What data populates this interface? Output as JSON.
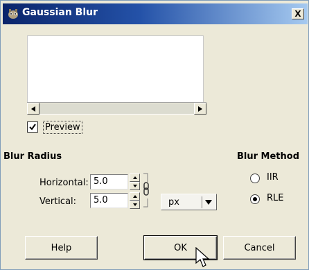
{
  "window": {
    "title": "Gaussian Blur",
    "close_label": "X"
  },
  "preview": {
    "checkbox_checked": true,
    "label": "Preview"
  },
  "blur_radius": {
    "section_title": "Blur Radius",
    "horizontal_label": "Horizontal:",
    "horizontal_value": "5.0",
    "vertical_label": "Vertical:",
    "vertical_value": "5.0",
    "unit": "px",
    "chain_linked": true
  },
  "blur_method": {
    "section_title": "Blur Method",
    "options": [
      {
        "label": "IIR",
        "selected": false
      },
      {
        "label": "RLE",
        "selected": true
      }
    ]
  },
  "buttons": {
    "help": "Help",
    "ok": "OK",
    "cancel": "Cancel"
  },
  "icons": {
    "title_icon": "gimp-icon",
    "chain_icon": "chain-link-icon"
  }
}
